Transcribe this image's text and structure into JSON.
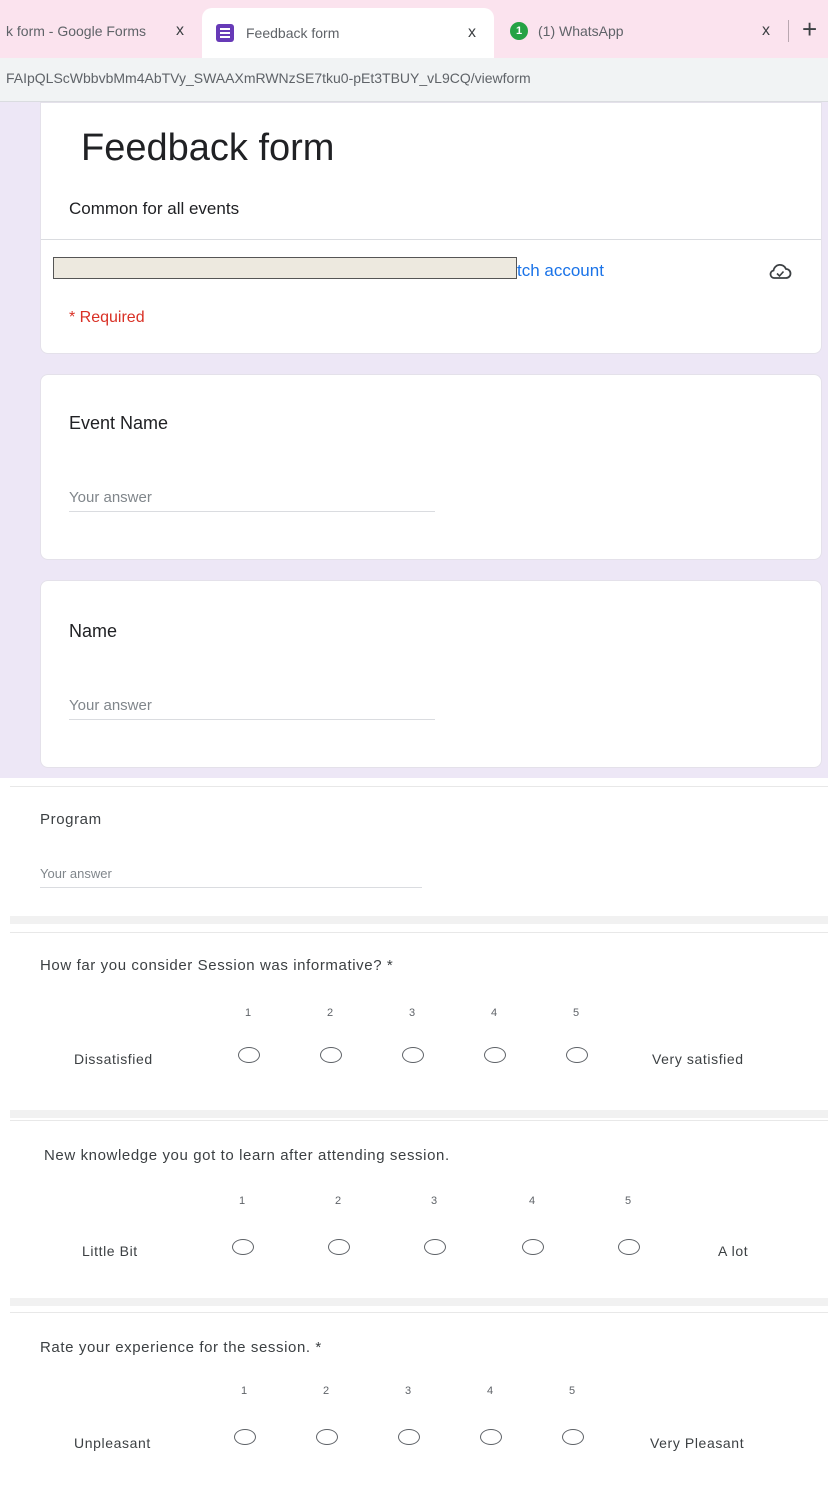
{
  "browser": {
    "tabs": [
      {
        "label": "k form - Google Forms",
        "close": "x"
      },
      {
        "label": "Feedback form",
        "close": "x"
      },
      {
        "label": "(1) WhatsApp",
        "badge": "1",
        "close": "x"
      }
    ],
    "new_tab": "+",
    "url": "FAIpQLScWbbvbMm4AbTVy_SWAAXmRWNzSE7tku0-pEt3TBUY_vL9CQ/viewform"
  },
  "form": {
    "title": "Feedback form",
    "description": "Common for all events",
    "switch_account": "tch account",
    "required_note": "* Required",
    "questions": [
      {
        "label": "Event Name",
        "placeholder": "Your answer"
      },
      {
        "label": "Name",
        "placeholder": "Your answer"
      },
      {
        "label": "Program",
        "placeholder": "Your answer"
      }
    ],
    "scales": [
      {
        "question": "How far you consider Session was informative? *",
        "numbers": [
          "1",
          "2",
          "3",
          "4",
          "5"
        ],
        "low_label": "Dissatisfied",
        "high_label": "Very satisfied"
      },
      {
        "question": "New knowledge you got to learn after attending session.",
        "numbers": [
          "1",
          "2",
          "3",
          "4",
          "5"
        ],
        "low_label": "Little Bit",
        "high_label": "A lot"
      },
      {
        "question": "Rate your experience for the session. *",
        "numbers": [
          "1",
          "2",
          "3",
          "4",
          "5"
        ],
        "low_label": "Unpleasant",
        "high_label": "Very Pleasant"
      }
    ]
  },
  "colors": {
    "tab_bar": "#fbe3ee",
    "forms_purple": "#673ab7",
    "page_background": "#ede7f6",
    "required_red": "#d93025",
    "link_blue": "#1a73e8"
  }
}
